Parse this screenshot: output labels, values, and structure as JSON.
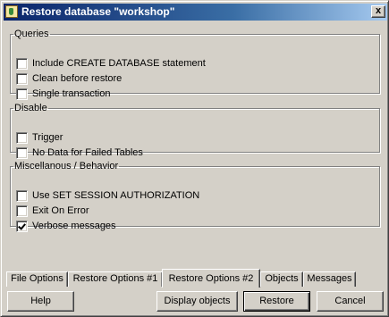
{
  "window": {
    "title": "Restore database \"workshop\"",
    "close_label": "x"
  },
  "groups": {
    "queries": {
      "label": "Queries",
      "items": [
        {
          "label": "Include CREATE DATABASE statement",
          "checked": false
        },
        {
          "label": "Clean before restore",
          "checked": false
        },
        {
          "label": "Single transaction",
          "checked": false
        }
      ]
    },
    "disable": {
      "label": "Disable",
      "items": [
        {
          "label": "Trigger",
          "checked": false
        },
        {
          "label": "No Data for Failed Tables",
          "checked": false
        }
      ]
    },
    "misc": {
      "label": "Miscellanous / Behavior",
      "items": [
        {
          "label": "Use SET SESSION AUTHORIZATION",
          "checked": false
        },
        {
          "label": "Exit On Error",
          "checked": false
        },
        {
          "label": "Verbose messages",
          "checked": true
        }
      ]
    }
  },
  "tabs": [
    {
      "label": "File Options",
      "active": false
    },
    {
      "label": "Restore Options #1",
      "active": false
    },
    {
      "label": "Restore Options #2",
      "active": true
    },
    {
      "label": "Objects",
      "active": false
    },
    {
      "label": "Messages",
      "active": false
    }
  ],
  "buttons": {
    "help": "Help",
    "display_objects": "Display objects",
    "restore": "Restore",
    "cancel": "Cancel"
  }
}
